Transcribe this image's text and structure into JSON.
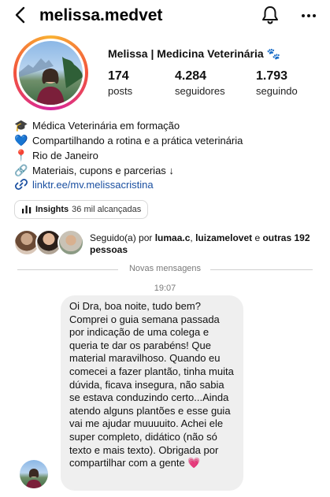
{
  "header": {
    "username": "melissa.medvet",
    "back_icon": "back-arrow-icon",
    "bell_icon": "bell-icon",
    "more_icon": "more-dots-icon"
  },
  "profile": {
    "display_name": "Melissa | Medicina Veterinária 🐾",
    "stats": [
      {
        "value": "174",
        "label": "posts"
      },
      {
        "value": "4.284",
        "label": "seguidores"
      },
      {
        "value": "1.793",
        "label": "seguindo"
      }
    ],
    "bio": [
      {
        "icon": "🎓",
        "text": "Médica Veterinária em formação"
      },
      {
        "icon": "💙",
        "text": "Compartilhando a rotina e a prática veterinária"
      },
      {
        "icon": "📍",
        "text": "Rio de Janeiro"
      },
      {
        "icon": "🔗",
        "text": "Materiais, cupons e parcerias ↓"
      }
    ],
    "link": "linktr.ee/mv.melissacristina",
    "insights": {
      "label": "Insights",
      "value": "36 mil alcançadas"
    }
  },
  "followed_by": {
    "prefix": "Seguido(a) por ",
    "user1": "lumaa.c",
    "sep": ", ",
    "user2": "luizamelovet",
    "middle": " e ",
    "others": "outras 192 pessoas"
  },
  "chat": {
    "new_messages_label": "Novas mensagens",
    "timestamp": "19:07",
    "message": "Oi Dra, boa noite, tudo bem? Comprei o guia semana passada por indicação de uma colega e queria te dar os parabéns! Que material maravilhoso. Quando eu comecei a fazer plantão, tinha muita dúvida, ficava insegura, não sabia se estava conduzindo certo...Ainda atendo alguns plantões e esse guia vai me ajudar muuuuito. Achei ele super completo, didático (não só texto e mais texto). Obrigada por compartilhar com a gente 💗"
  },
  "colors": {
    "link": "#1a4fa0",
    "bubble": "#efefef",
    "muted_text": "#7a7a7a",
    "ring_start": "#f9b233",
    "ring_mid": "#d6249f"
  }
}
